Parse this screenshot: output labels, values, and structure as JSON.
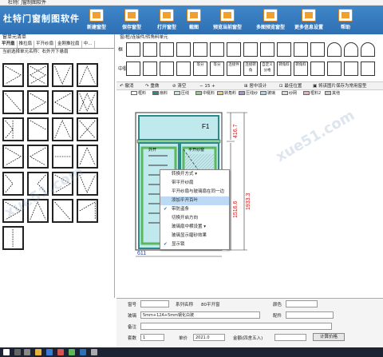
{
  "app": {
    "title": "杜特门窗制图软件",
    "window_caption": "杜特门窗制图软件"
  },
  "ribbon": {
    "tools": [
      {
        "label": "新建窗型",
        "icon": "new-file-icon"
      },
      {
        "label": "保存窗型",
        "icon": "save-icon"
      },
      {
        "label": "打开窗型",
        "icon": "open-folder-icon"
      },
      {
        "label": "截图",
        "icon": "screenshot-icon"
      },
      {
        "label": "预览当前窗型",
        "icon": "preview-icon"
      },
      {
        "label": "多图预览窗型",
        "icon": "multi-preview-icon"
      },
      {
        "label": "更多信息设置",
        "icon": "settings-icon"
      },
      {
        "label": "帮助",
        "icon": "help-icon"
      }
    ]
  },
  "left_panel": {
    "title": "窗单元清单",
    "tabs": [
      "平开扇",
      "推拉扇",
      "平开纱扇",
      "金刚推拉扇",
      "中…"
    ],
    "current": "当前选择单元名称：右外开下悬扇"
  },
  "main": {
    "title": "窗/框/连接件/转角料单元",
    "row_labels": {
      "frame": "框",
      "mullion": "中梃"
    },
    "mullion_labels": [
      "等分",
      "等分",
      "连接件",
      "连接转角",
      "自定义分格",
      "转角料",
      "转角料"
    ]
  },
  "toolbar": {
    "undo": "撤消",
    "redo": "重做",
    "clear": "清空",
    "zoom_value": "15",
    "center_design": "居中设计",
    "origin": "最佳位置",
    "save_image": "将该图片保存为常用窗型"
  },
  "legend": [
    "框料",
    "扇料",
    "压线",
    "中梃料",
    "转角料",
    "压线纱",
    "玻璃",
    "纱网",
    "框料2",
    "其他"
  ],
  "drawing": {
    "panel_label": "F1",
    "left_sash_label": "外开",
    "right_sash_label": "平开纱窗",
    "dim_top_height": "416.7",
    "dim_bottom_height": "1516.6",
    "dim_total_height": "1933.3",
    "dim_width_fragment": "611"
  },
  "context_menu": {
    "items": [
      {
        "label": "转换开方式",
        "checked": false,
        "submenu": true
      },
      {
        "label": "带平开纱扇",
        "checked": false
      },
      {
        "label": "平开纱扇与玻璃扇在同一边",
        "checked": false
      },
      {
        "label": "添加平开百叶",
        "checked": false,
        "highlighted": true
      },
      {
        "label": "带防盗条",
        "checked": true
      },
      {
        "label": "切换开启方向",
        "checked": false
      },
      {
        "label": "玻璃扇中横设置",
        "checked": false,
        "submenu": true
      },
      {
        "label": "玻璃显示磨砂效果",
        "checked": false
      },
      {
        "label": "显示锁",
        "checked": true
      }
    ]
  },
  "bottom": {
    "window_no_label": "窗号",
    "window_no": "",
    "series_label": "系列名称",
    "series": "80平开窗",
    "color_label": "颜色",
    "color": "",
    "glass_label": "玻璃",
    "glass": "5mm+12A+5mm钢化白玻",
    "accessory_label": "配件",
    "accessory": "",
    "remark_label": "备注",
    "remark": "",
    "quantity_label": "套数",
    "quantity": "1",
    "unit_price_label": "单价",
    "unit_price": "2021.0",
    "amount_label": "金额(四舍五入)",
    "amount": "",
    "calc_button": "计算价格"
  },
  "watermark": "xue51.com"
}
